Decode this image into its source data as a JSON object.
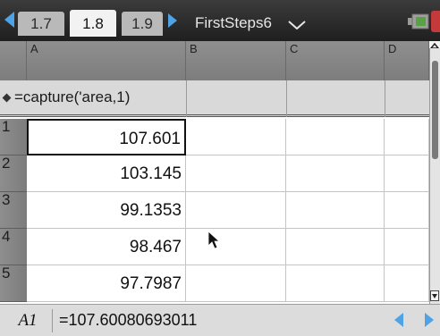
{
  "tabs": [
    {
      "label": "1.7",
      "active": false
    },
    {
      "label": "1.8",
      "active": true
    },
    {
      "label": "1.9",
      "active": false
    }
  ],
  "document_title": "FirstSteps6",
  "columns": [
    "A",
    "B",
    "C",
    "D"
  ],
  "formula_row": {
    "a": "=capture('area,1)"
  },
  "rows": [
    {
      "num": "1",
      "a": "107.601"
    },
    {
      "num": "2",
      "a": "103.145"
    },
    {
      "num": "3",
      "a": "99.1353"
    },
    {
      "num": "4",
      "a": "98.467"
    },
    {
      "num": "5",
      "a": "97.7987"
    }
  ],
  "entry_line": {
    "cell_ref": "A1",
    "value": "=107.60080693011"
  },
  "colors": {
    "accent": "#4ea3e6",
    "close": "#c43a3a",
    "header_gray": "#8a8a8a"
  },
  "icons": [
    "nav-left-icon",
    "nav-right-icon",
    "chevron-down-icon",
    "battery-icon",
    "close-icon",
    "diamond-icon",
    "pointer-icon",
    "scroll-up-icon",
    "scroll-down-icon"
  ]
}
